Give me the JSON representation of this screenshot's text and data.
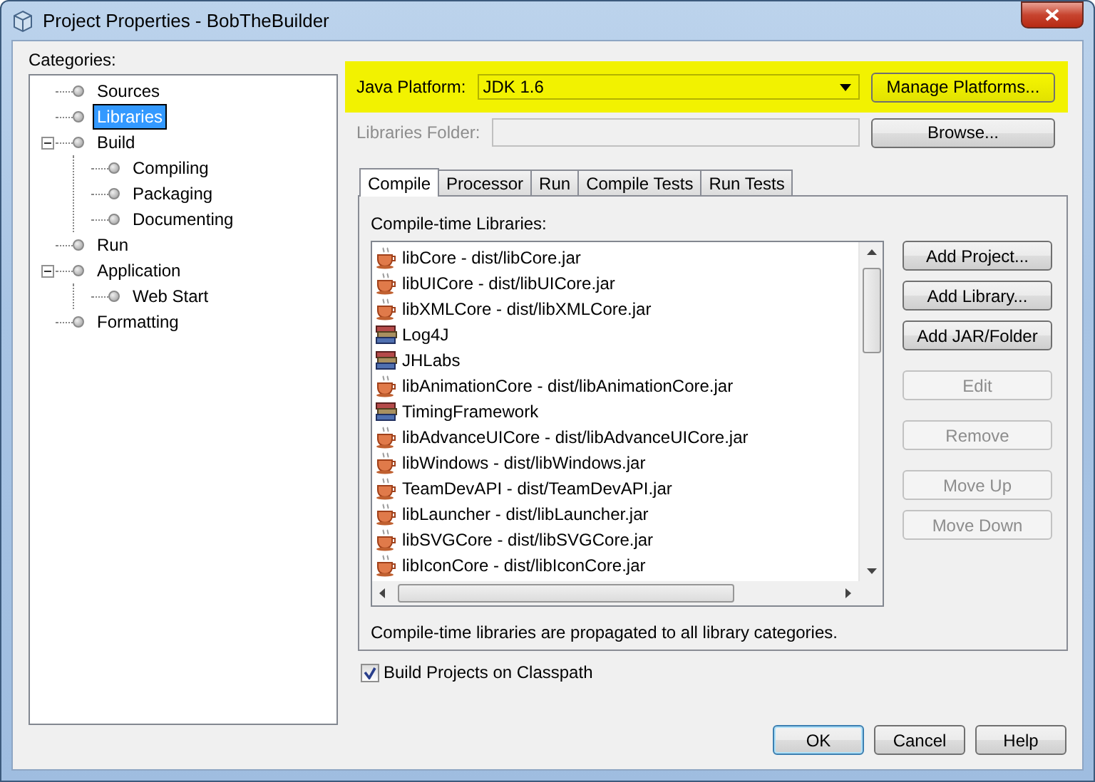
{
  "window": {
    "title": "Project Properties - BobTheBuilder"
  },
  "categories": {
    "label": "Categories:",
    "items": [
      {
        "label": "Sources",
        "selected": false
      },
      {
        "label": "Libraries",
        "selected": true
      },
      {
        "label": "Build",
        "selected": false,
        "expanded": true,
        "children": [
          {
            "label": "Compiling",
            "selected": false
          },
          {
            "label": "Packaging",
            "selected": false
          },
          {
            "label": "Documenting",
            "selected": false
          }
        ]
      },
      {
        "label": "Run",
        "selected": false
      },
      {
        "label": "Application",
        "selected": false,
        "expanded": true,
        "children": [
          {
            "label": "Web Start",
            "selected": false
          }
        ]
      },
      {
        "label": "Formatting",
        "selected": false
      }
    ]
  },
  "platform": {
    "label": "Java Platform:",
    "value": "JDK 1.6",
    "button": "Manage Platforms...",
    "highlighted": true
  },
  "libraries_folder": {
    "label": "Libraries Folder:",
    "button": "Browse...",
    "disabled": true
  },
  "tabs": [
    {
      "label": "Compile",
      "selected": true
    },
    {
      "label": "Processor",
      "selected": false
    },
    {
      "label": "Run",
      "selected": false
    },
    {
      "label": "Compile Tests",
      "selected": false
    },
    {
      "label": "Run Tests",
      "selected": false
    }
  ],
  "compile": {
    "list_label": "Compile-time Libraries:",
    "libraries": [
      {
        "name": "libCore - dist/libCore.jar",
        "kind": "jar"
      },
      {
        "name": "libUICore - dist/libUICore.jar",
        "kind": "jar"
      },
      {
        "name": "libXMLCore - dist/libXMLCore.jar",
        "kind": "jar"
      },
      {
        "name": "Log4J",
        "kind": "library"
      },
      {
        "name": "JHLabs",
        "kind": "library"
      },
      {
        "name": "libAnimationCore - dist/libAnimationCore.jar",
        "kind": "jar"
      },
      {
        "name": "TimingFramework",
        "kind": "library"
      },
      {
        "name": "libAdvanceUICore - dist/libAdvanceUICore.jar",
        "kind": "jar"
      },
      {
        "name": "libWindows - dist/libWindows.jar",
        "kind": "jar"
      },
      {
        "name": "TeamDevAPI - dist/TeamDevAPI.jar",
        "kind": "jar"
      },
      {
        "name": "libLauncher - dist/libLauncher.jar",
        "kind": "jar"
      },
      {
        "name": "libSVGCore - dist/libSVGCore.jar",
        "kind": "jar"
      },
      {
        "name": "libIconCore - dist/libIconCore.jar",
        "kind": "jar"
      }
    ],
    "button_groups": [
      [
        {
          "label": "Add Project...",
          "disabled": false
        },
        {
          "label": "Add Library...",
          "disabled": false
        },
        {
          "label": "Add JAR/Folder",
          "disabled": false
        }
      ],
      [
        {
          "label": "Edit",
          "disabled": true
        }
      ],
      [
        {
          "label": "Remove",
          "disabled": true
        }
      ],
      [
        {
          "label": "Move Up",
          "disabled": true
        },
        {
          "label": "Move Down",
          "disabled": true
        }
      ]
    ],
    "note": "Compile-time libraries are propagated to all library categories."
  },
  "build_on_classpath": {
    "label": "Build Projects on Classpath",
    "checked": true
  },
  "dialog_buttons": [
    {
      "label": "OK",
      "default": true
    },
    {
      "label": "Cancel",
      "default": false
    },
    {
      "label": "Help",
      "default": false
    }
  ]
}
